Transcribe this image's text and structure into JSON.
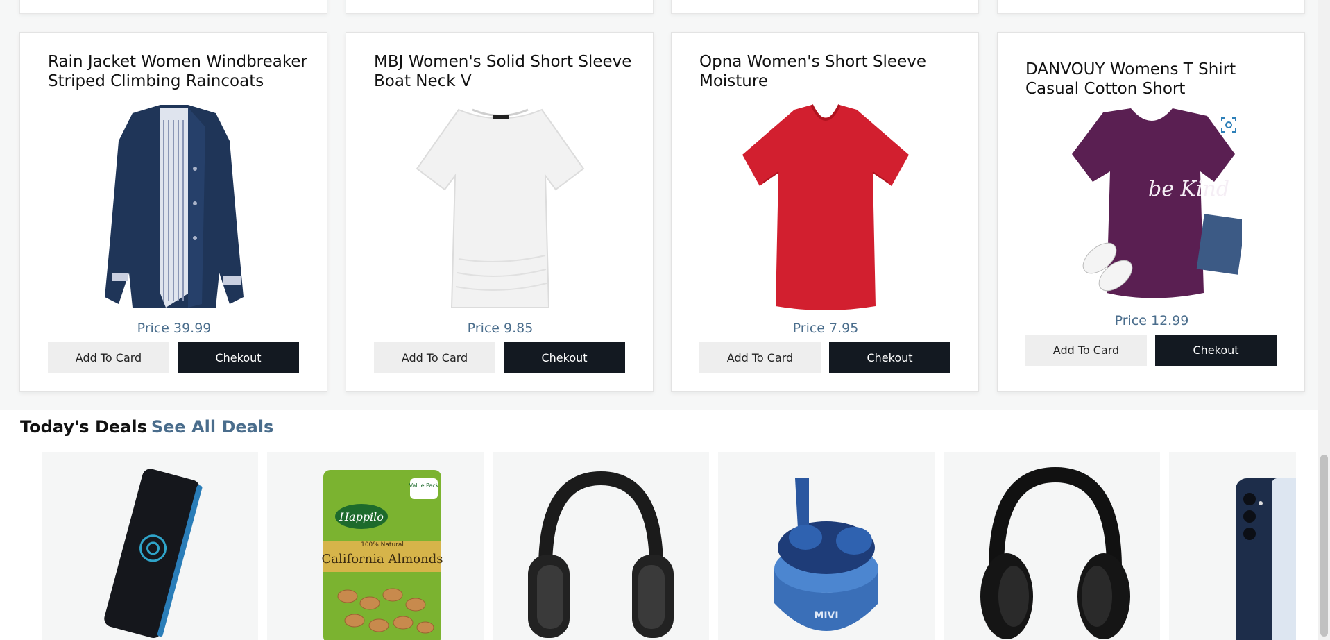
{
  "products": [
    {
      "title": "Rain Jacket Women Windbreaker Striped Climbing Raincoats",
      "price_label": "Price 39.99",
      "add_label": "Add To Card",
      "checkout_label": "Chekout",
      "image": "navy-jacket-image"
    },
    {
      "title": "MBJ Women's Solid Short Sleeve Boat Neck V",
      "price_label": "Price 9.85",
      "add_label": "Add To Card",
      "checkout_label": "Chekout",
      "image": "white-top-image"
    },
    {
      "title": "Opna Women's Short Sleeve Moisture",
      "price_label": "Price 7.95",
      "add_label": "Add To Card",
      "checkout_label": "Chekout",
      "image": "red-tshirt-image"
    },
    {
      "title": "DANVOUY Womens T Shirt Casual Cotton Short",
      "price_label": "Price 12.99",
      "add_label": "Add To Card",
      "checkout_label": "Chekout",
      "image": "purple-tshirt-image",
      "shirt_text": "be Kind"
    }
  ],
  "deals": {
    "title": "Today's Deals",
    "link_label": "See All Deals",
    "items": [
      {
        "image": "power-bank-image"
      },
      {
        "image": "almonds-pack-image",
        "brand": "Happilo",
        "product": "California Almonds",
        "sub": "100% Natural",
        "badge": "Value Pack"
      },
      {
        "image": "black-headphones-image"
      },
      {
        "image": "blue-earbuds-image",
        "brand": "MIVI"
      },
      {
        "image": "black-headphones-2-image"
      },
      {
        "image": "smartphone-image"
      }
    ]
  },
  "colors": {
    "accent": "#4a6d8c",
    "dark_button": "#131921",
    "light_button": "#eeeeee"
  }
}
